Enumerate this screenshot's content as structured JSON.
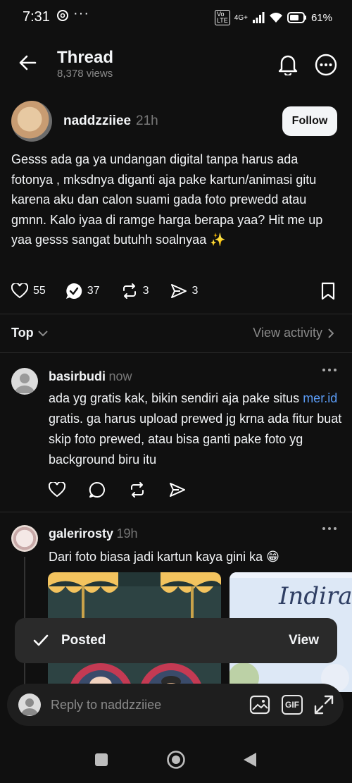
{
  "status_bar": {
    "time": "7:31",
    "dots": "···",
    "network": "4G+",
    "battery": "61%"
  },
  "header": {
    "title": "Thread",
    "views": "8,378 views"
  },
  "post": {
    "author": "naddzziiee",
    "time": "21h",
    "follow_label": "Follow",
    "text": "Gesss ada ga ya undangan digital tanpa harus ada fotonya , mksdnya diganti aja pake kartun/animasi gitu karena aku dan calon suami gada foto prewedd atau gmnn. Kalo iyaa di ramge harga berapa yaa? Hit me up yaa gesss sangat butuhh soalnyaa ✨",
    "likes": "55",
    "replies": "37",
    "reposts": "3",
    "shares": "3"
  },
  "sort": {
    "label": "Top",
    "view_activity": "View activity"
  },
  "replies": [
    {
      "author": "basirbudi",
      "time": "now",
      "text_before_link": "ada yg gratis kak, bikin sendiri aja pake situs ",
      "link": "mer.id",
      "text_after_link": " gratis. ga harus upload prewed jg krna ada fitur buat skip foto prewed, atau bisa ganti pake foto yg background biru itu"
    },
    {
      "author": "galerirosty",
      "time": "19h",
      "text": "Dari foto biasa jadi kartun kaya gini ka 😁",
      "image2_script": "Indira"
    }
  ],
  "toast": {
    "label": "Posted",
    "action": "View"
  },
  "reply_bar": {
    "placeholder": "Reply to naddzziiee",
    "gif_label": "GIF"
  }
}
